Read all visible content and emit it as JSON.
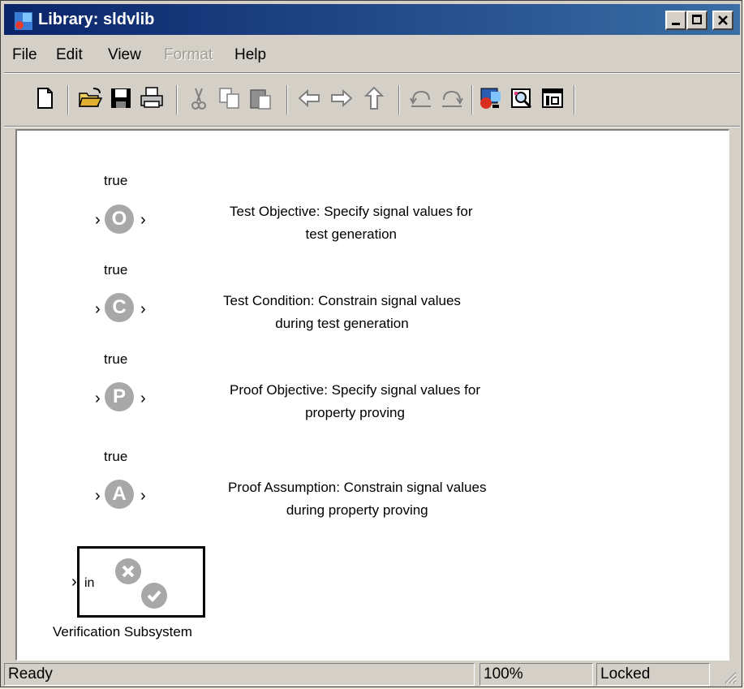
{
  "window": {
    "title": "Library: sldvlib",
    "controls": {
      "minimize": "minimize",
      "maximize": "maximize",
      "close": "close"
    }
  },
  "menu": {
    "items": [
      {
        "label": "File",
        "enabled": true
      },
      {
        "label": "Edit",
        "enabled": true
      },
      {
        "label": "View",
        "enabled": true
      },
      {
        "label": "Format",
        "enabled": false
      },
      {
        "label": "Help",
        "enabled": true
      }
    ]
  },
  "toolbar": {
    "buttons": [
      "new-document-icon",
      "open-folder-icon",
      "save-icon",
      "print-icon",
      "cut-icon",
      "copy-icon",
      "paste-icon",
      "back-arrow-icon",
      "forward-arrow-icon",
      "up-arrow-icon",
      "undo-icon",
      "redo-icon",
      "library-browser-icon",
      "model-explorer-icon",
      "debugger-icon"
    ]
  },
  "canvas": {
    "blocks": [
      {
        "signal": "true",
        "letter": "O",
        "description": [
          "Test Objective: Specify signal values for",
          "test generation"
        ]
      },
      {
        "signal": "true",
        "letter": "C",
        "description": [
          "Test Condition: Constrain signal values",
          "during test generation"
        ]
      },
      {
        "signal": "true",
        "letter": "P",
        "description": [
          "Proof Objective: Specify signal values for",
          "property proving"
        ]
      },
      {
        "signal": "true",
        "letter": "A",
        "description": [
          "Proof Assumption: Constrain signal values",
          "during property proving"
        ]
      }
    ],
    "subsystem": {
      "port_label": "in",
      "name": "Verification Subsystem"
    }
  },
  "status": {
    "message": "Ready",
    "zoom": "100%",
    "lock_state": "Locked"
  },
  "colors": {
    "title_bar_start": "#0a246a",
    "title_bar_end": "#3a6ea5",
    "block_gray": "#a8a8a8",
    "window_face": "#d4d0c8"
  }
}
